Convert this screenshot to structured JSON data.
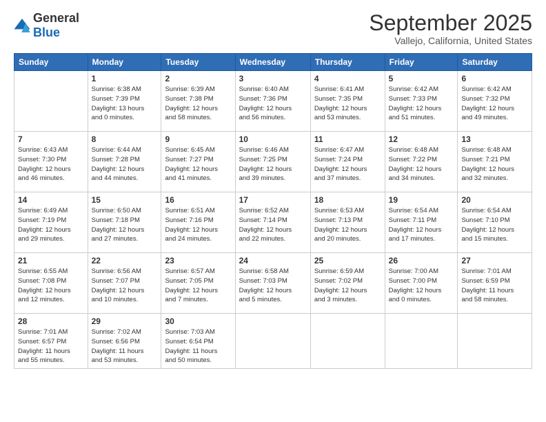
{
  "logo": {
    "general": "General",
    "blue": "Blue"
  },
  "header": {
    "month": "September 2025",
    "location": "Vallejo, California, United States"
  },
  "weekdays": [
    "Sunday",
    "Monday",
    "Tuesday",
    "Wednesday",
    "Thursday",
    "Friday",
    "Saturday"
  ],
  "weeks": [
    [
      {
        "day": "",
        "info": ""
      },
      {
        "day": "1",
        "info": "Sunrise: 6:38 AM\nSunset: 7:39 PM\nDaylight: 13 hours\nand 0 minutes."
      },
      {
        "day": "2",
        "info": "Sunrise: 6:39 AM\nSunset: 7:38 PM\nDaylight: 12 hours\nand 58 minutes."
      },
      {
        "day": "3",
        "info": "Sunrise: 6:40 AM\nSunset: 7:36 PM\nDaylight: 12 hours\nand 56 minutes."
      },
      {
        "day": "4",
        "info": "Sunrise: 6:41 AM\nSunset: 7:35 PM\nDaylight: 12 hours\nand 53 minutes."
      },
      {
        "day": "5",
        "info": "Sunrise: 6:42 AM\nSunset: 7:33 PM\nDaylight: 12 hours\nand 51 minutes."
      },
      {
        "day": "6",
        "info": "Sunrise: 6:42 AM\nSunset: 7:32 PM\nDaylight: 12 hours\nand 49 minutes."
      }
    ],
    [
      {
        "day": "7",
        "info": "Sunrise: 6:43 AM\nSunset: 7:30 PM\nDaylight: 12 hours\nand 46 minutes."
      },
      {
        "day": "8",
        "info": "Sunrise: 6:44 AM\nSunset: 7:28 PM\nDaylight: 12 hours\nand 44 minutes."
      },
      {
        "day": "9",
        "info": "Sunrise: 6:45 AM\nSunset: 7:27 PM\nDaylight: 12 hours\nand 41 minutes."
      },
      {
        "day": "10",
        "info": "Sunrise: 6:46 AM\nSunset: 7:25 PM\nDaylight: 12 hours\nand 39 minutes."
      },
      {
        "day": "11",
        "info": "Sunrise: 6:47 AM\nSunset: 7:24 PM\nDaylight: 12 hours\nand 37 minutes."
      },
      {
        "day": "12",
        "info": "Sunrise: 6:48 AM\nSunset: 7:22 PM\nDaylight: 12 hours\nand 34 minutes."
      },
      {
        "day": "13",
        "info": "Sunrise: 6:48 AM\nSunset: 7:21 PM\nDaylight: 12 hours\nand 32 minutes."
      }
    ],
    [
      {
        "day": "14",
        "info": "Sunrise: 6:49 AM\nSunset: 7:19 PM\nDaylight: 12 hours\nand 29 minutes."
      },
      {
        "day": "15",
        "info": "Sunrise: 6:50 AM\nSunset: 7:18 PM\nDaylight: 12 hours\nand 27 minutes."
      },
      {
        "day": "16",
        "info": "Sunrise: 6:51 AM\nSunset: 7:16 PM\nDaylight: 12 hours\nand 24 minutes."
      },
      {
        "day": "17",
        "info": "Sunrise: 6:52 AM\nSunset: 7:14 PM\nDaylight: 12 hours\nand 22 minutes."
      },
      {
        "day": "18",
        "info": "Sunrise: 6:53 AM\nSunset: 7:13 PM\nDaylight: 12 hours\nand 20 minutes."
      },
      {
        "day": "19",
        "info": "Sunrise: 6:54 AM\nSunset: 7:11 PM\nDaylight: 12 hours\nand 17 minutes."
      },
      {
        "day": "20",
        "info": "Sunrise: 6:54 AM\nSunset: 7:10 PM\nDaylight: 12 hours\nand 15 minutes."
      }
    ],
    [
      {
        "day": "21",
        "info": "Sunrise: 6:55 AM\nSunset: 7:08 PM\nDaylight: 12 hours\nand 12 minutes."
      },
      {
        "day": "22",
        "info": "Sunrise: 6:56 AM\nSunset: 7:07 PM\nDaylight: 12 hours\nand 10 minutes."
      },
      {
        "day": "23",
        "info": "Sunrise: 6:57 AM\nSunset: 7:05 PM\nDaylight: 12 hours\nand 7 minutes."
      },
      {
        "day": "24",
        "info": "Sunrise: 6:58 AM\nSunset: 7:03 PM\nDaylight: 12 hours\nand 5 minutes."
      },
      {
        "day": "25",
        "info": "Sunrise: 6:59 AM\nSunset: 7:02 PM\nDaylight: 12 hours\nand 3 minutes."
      },
      {
        "day": "26",
        "info": "Sunrise: 7:00 AM\nSunset: 7:00 PM\nDaylight: 12 hours\nand 0 minutes."
      },
      {
        "day": "27",
        "info": "Sunrise: 7:01 AM\nSunset: 6:59 PM\nDaylight: 11 hours\nand 58 minutes."
      }
    ],
    [
      {
        "day": "28",
        "info": "Sunrise: 7:01 AM\nSunset: 6:57 PM\nDaylight: 11 hours\nand 55 minutes."
      },
      {
        "day": "29",
        "info": "Sunrise: 7:02 AM\nSunset: 6:56 PM\nDaylight: 11 hours\nand 53 minutes."
      },
      {
        "day": "30",
        "info": "Sunrise: 7:03 AM\nSunset: 6:54 PM\nDaylight: 11 hours\nand 50 minutes."
      },
      {
        "day": "",
        "info": ""
      },
      {
        "day": "",
        "info": ""
      },
      {
        "day": "",
        "info": ""
      },
      {
        "day": "",
        "info": ""
      }
    ]
  ]
}
